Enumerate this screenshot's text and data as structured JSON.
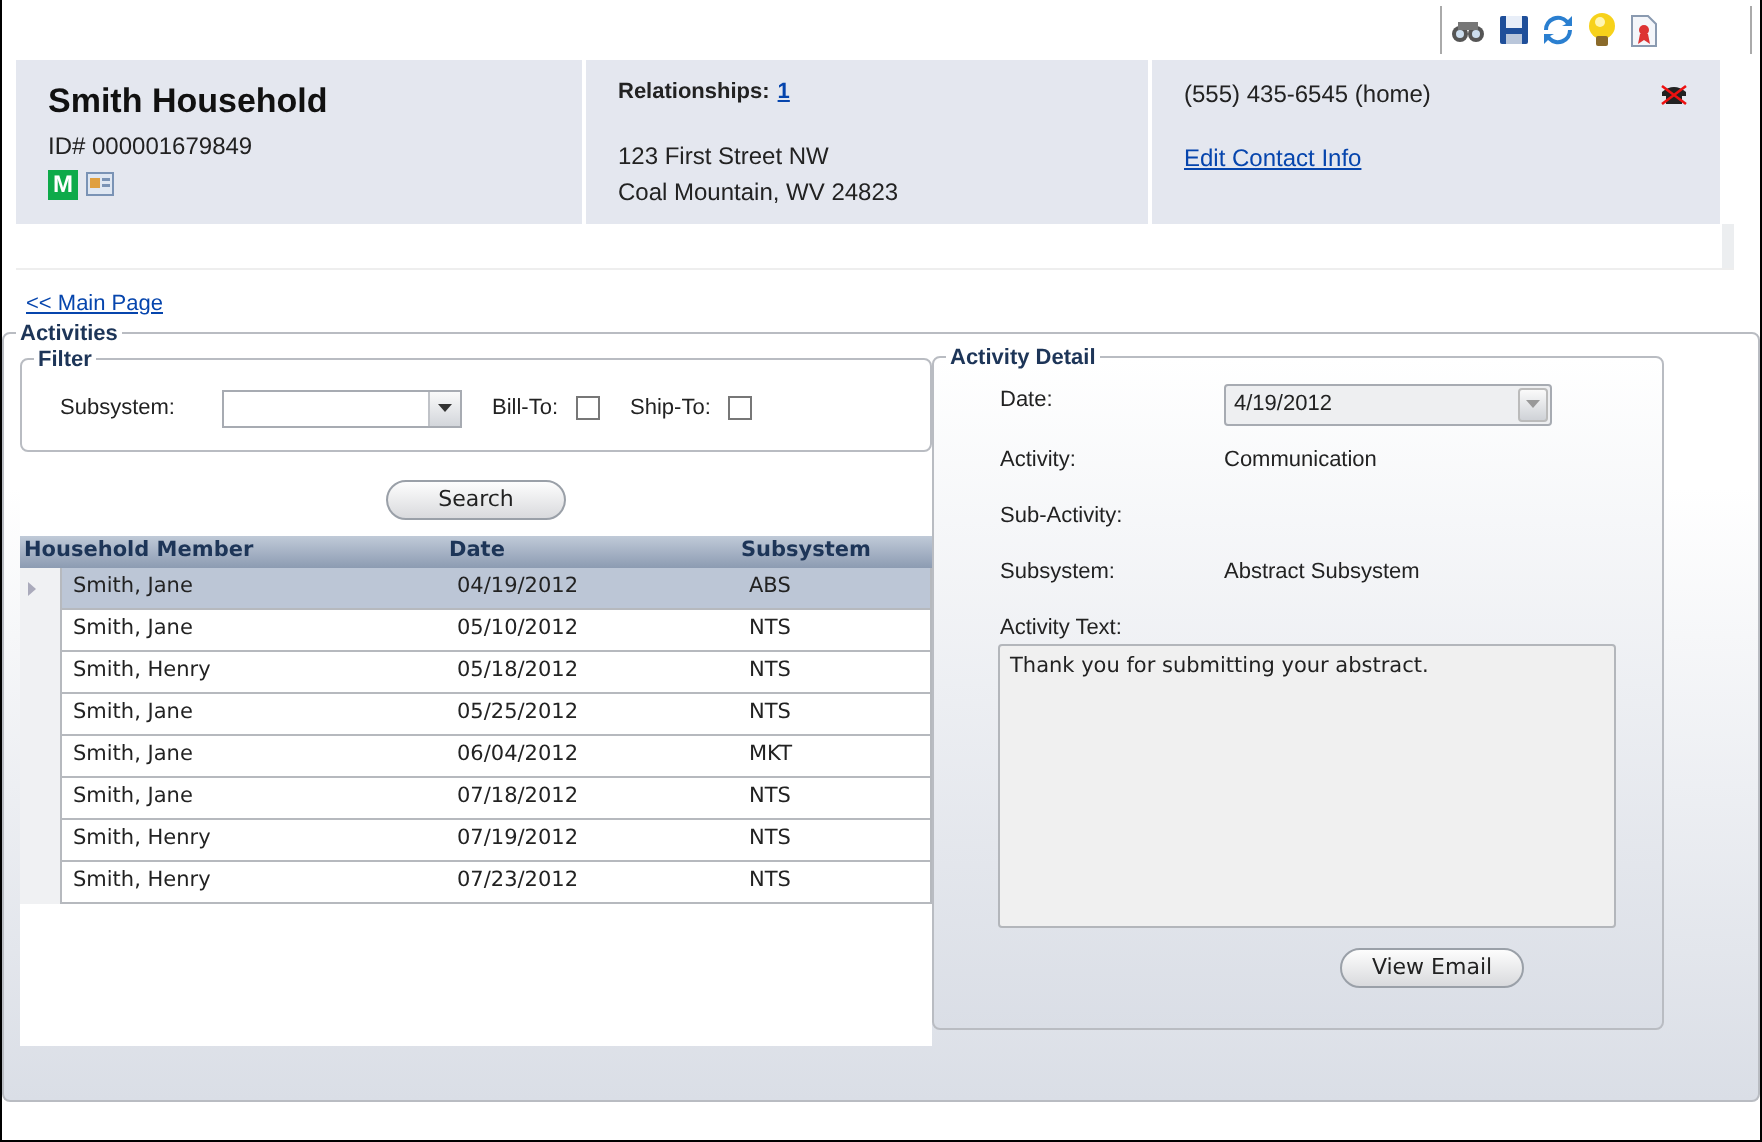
{
  "household": {
    "name": "Smith Household",
    "id": "ID# 000001679849",
    "badge": "M"
  },
  "relationships": {
    "label": "Relationships:",
    "count": "1"
  },
  "address": [
    "123 First Street NW",
    "Coal Mountain, WV 24823"
  ],
  "contact": {
    "phone": "(555) 435-6545 (home)",
    "edit_link": "Edit Contact Info"
  },
  "back_link": "<< Main Page",
  "activities": {
    "title": "Activities",
    "filter": {
      "title": "Filter",
      "subsystem_label": "Subsystem:",
      "checks": [
        {
          "label": "Bill-To:",
          "checked": false
        },
        {
          "label": "Ship-To:",
          "checked": false
        }
      ]
    },
    "search_button": "Search",
    "table": {
      "columns": [
        "Household Member",
        "Date",
        "Subsystem"
      ],
      "rows": [
        {
          "cells": [
            "Smith, Jane",
            "04/19/2012",
            "ABS"
          ],
          "selected": true
        },
        {
          "cells": [
            "Smith, Jane",
            "05/10/2012",
            "NTS"
          ],
          "selected": false
        },
        {
          "cells": [
            "Smith, Henry",
            "05/18/2012",
            "NTS"
          ],
          "selected": false
        },
        {
          "cells": [
            "Smith, Jane",
            "05/25/2012",
            "NTS"
          ],
          "selected": false
        },
        {
          "cells": [
            "Smith, Jane",
            "06/04/2012",
            "MKT"
          ],
          "selected": false
        },
        {
          "cells": [
            "Smith, Jane",
            "07/18/2012",
            "NTS"
          ],
          "selected": false
        },
        {
          "cells": [
            "Smith, Henry",
            "07/19/2012",
            "NTS"
          ],
          "selected": false
        },
        {
          "cells": [
            "Smith, Henry",
            "07/23/2012",
            "NTS"
          ],
          "selected": false
        }
      ]
    }
  },
  "detail": {
    "title": "Activity Detail",
    "fields": [
      {
        "kind": "dropdown",
        "label": "Date:",
        "value": "4/19/2012"
      },
      {
        "kind": "text",
        "label": "Activity:",
        "value": "Communication"
      },
      {
        "kind": "text",
        "label": "Sub-Activity:"
      },
      {
        "kind": "text",
        "label": "Subsystem:",
        "value": "Abstract Subsystem"
      },
      {
        "kind": "textarea",
        "label": "Activity Text:",
        "value": "Thank you for submitting your abstract."
      }
    ],
    "button": "View Email"
  }
}
